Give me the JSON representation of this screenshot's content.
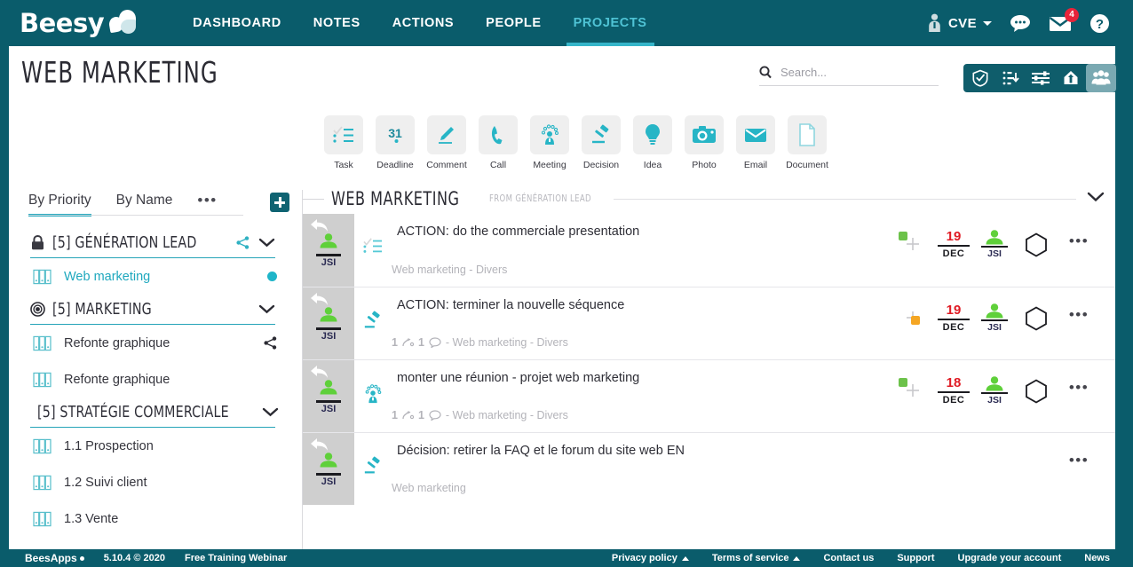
{
  "topnav": {
    "brand": "Beesy",
    "items": [
      {
        "label": "DASHBOARD",
        "active": false
      },
      {
        "label": "NOTES",
        "active": false
      },
      {
        "label": "ACTIONS",
        "active": false
      },
      {
        "label": "PEOPLE",
        "active": false
      },
      {
        "label": "PROJECTS",
        "active": true
      }
    ],
    "user": "CVE",
    "mail_badge": "4"
  },
  "header": {
    "page_title": "WEB MARKETING",
    "search_placeholder": "Search...",
    "search_value": "",
    "view_buttons": [
      {
        "name": "validation-icon",
        "active": false
      },
      {
        "name": "priority-sort-icon",
        "active": false
      },
      {
        "name": "filters-icon",
        "active": false
      },
      {
        "name": "export-icon",
        "active": false
      },
      {
        "name": "people-view-icon",
        "active": true
      }
    ]
  },
  "quickbar": [
    {
      "label": "Task",
      "icon": "task-icon"
    },
    {
      "label": "Deadline",
      "icon": "deadline-icon"
    },
    {
      "label": "Comment",
      "icon": "comment-icon"
    },
    {
      "label": "Call",
      "icon": "call-icon"
    },
    {
      "label": "Meeting",
      "icon": "meeting-icon"
    },
    {
      "label": "Decision",
      "icon": "decision-icon"
    },
    {
      "label": "Idea",
      "icon": "idea-icon"
    },
    {
      "label": "Photo",
      "icon": "photo-icon"
    },
    {
      "label": "Email",
      "icon": "email-icon"
    },
    {
      "label": "Document",
      "icon": "document-icon"
    }
  ],
  "sidebar": {
    "tabs": [
      {
        "label": "By Priority",
        "active": true
      },
      {
        "label": "By Name",
        "active": false
      }
    ],
    "more_label": "•••",
    "groups": [
      {
        "title": "[5] GÉNÉRATION LEAD",
        "icon": "lock-icon",
        "has_share": true,
        "projects": [
          {
            "name": "Web marketing",
            "selected": true,
            "has_dot": true,
            "has_share": false
          }
        ]
      },
      {
        "title": "[5] MARKETING",
        "icon": "target-icon",
        "has_share": false,
        "projects": [
          {
            "name": "Refonte graphique",
            "selected": false,
            "has_dot": false,
            "has_share": true
          },
          {
            "name": "Refonte graphique",
            "selected": false,
            "has_dot": false,
            "has_share": false
          }
        ]
      },
      {
        "title": "[5] STRATÉGIE COMMERCIALE",
        "icon": "target-icon",
        "has_share": false,
        "projects": [
          {
            "name": "1.1 Prospection",
            "selected": false,
            "has_dot": false,
            "has_share": false
          },
          {
            "name": "1.2 Suivi client",
            "selected": false,
            "has_dot": false,
            "has_share": false
          },
          {
            "name": "1.3 Vente",
            "selected": false,
            "has_dot": false,
            "has_share": false
          }
        ]
      }
    ]
  },
  "feed": {
    "project_title": "WEB MARKETING",
    "project_from": "FROM GÉNÉRATION LEAD",
    "rows": [
      {
        "avatar_label": "JSI",
        "type_icon": "task-icon",
        "title": "ACTION: do the commerciale presentation",
        "meta_counts": "",
        "meta_text": "Web marketing - Divers",
        "status_color": "#6cc24a",
        "status_pos": "left",
        "date_day": "19",
        "date_month": "DEC",
        "owner_label": "JSI",
        "has_hex": true,
        "has_date": true
      },
      {
        "avatar_label": "JSI",
        "type_icon": "decision-icon",
        "title": "ACTION: terminer la nouvelle séquence",
        "meta_counts": "1",
        "meta_counts2": "1",
        "meta_text": "- Web marketing - Divers",
        "status_color": "#f5a623",
        "status_pos": "right",
        "date_day": "19",
        "date_month": "DEC",
        "owner_label": "JSI",
        "has_hex": true,
        "has_date": true
      },
      {
        "avatar_label": "JSI",
        "type_icon": "meeting-icon",
        "title": "monter une réunion - projet web marketing",
        "meta_counts": "1",
        "meta_counts2": "1",
        "meta_text": "- Web marketing - Divers",
        "status_color": "#6cc24a",
        "status_pos": "left",
        "date_day": "18",
        "date_month": "DEC",
        "owner_label": "JSI",
        "has_hex": true,
        "has_date": true
      },
      {
        "avatar_label": "JSI",
        "type_icon": "decision-icon",
        "title": "Décision: retirer la FAQ et le forum du site web EN",
        "meta_counts": "",
        "meta_text": "Web marketing",
        "status_color": "",
        "status_pos": "",
        "date_day": "",
        "date_month": "",
        "owner_label": "",
        "has_hex": false,
        "has_date": false
      }
    ]
  },
  "footer": {
    "brand": "BeesApps",
    "version": "5.10.4 © 2020",
    "webinar": "Free Training Webinar",
    "links": [
      {
        "label": "Privacy policy",
        "caret": true
      },
      {
        "label": "Terms of service",
        "caret": true
      },
      {
        "label": "Contact us",
        "caret": false
      },
      {
        "label": "Support",
        "caret": false
      },
      {
        "label": "Upgrade your account",
        "caret": false
      },
      {
        "label": "News",
        "caret": false
      }
    ]
  },
  "colors": {
    "brand_teal": "#0a5c6b",
    "accent": "#1fa8be",
    "danger": "#e01b24",
    "green": "#6cc24a",
    "orange": "#f5a623"
  }
}
